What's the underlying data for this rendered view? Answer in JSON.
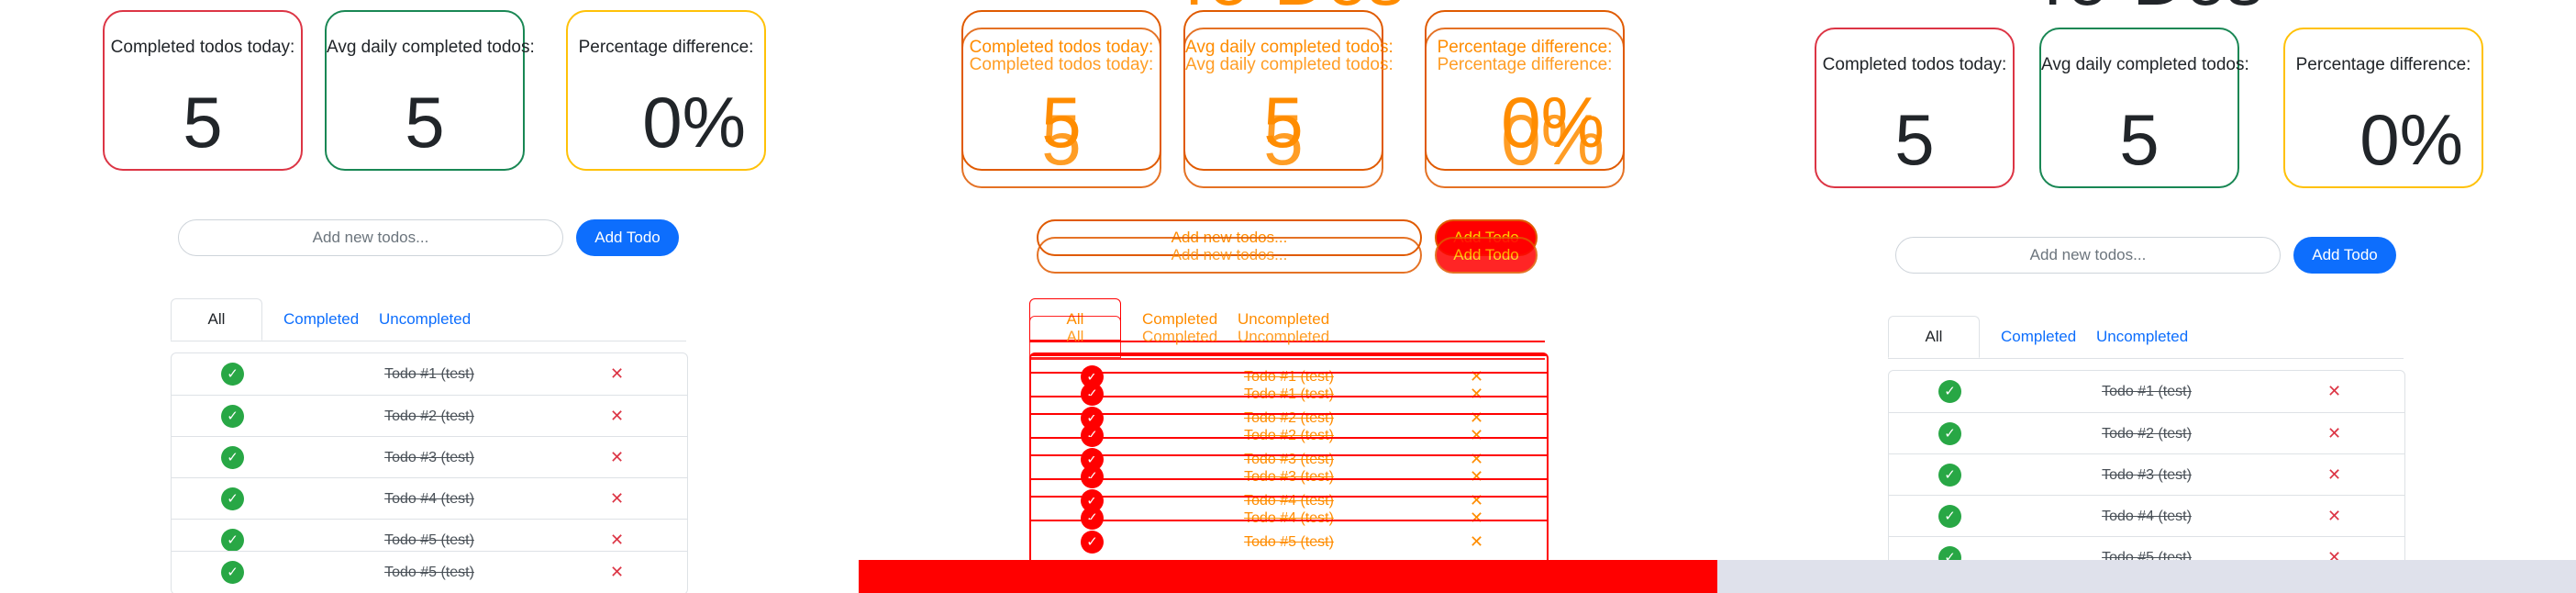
{
  "app": {
    "title": "To-Dos"
  },
  "stats": {
    "completed_today_label": "Completed todos today:",
    "completed_today_value": "5",
    "avg_daily_label": "Avg daily completed todos:",
    "avg_daily_value": "5",
    "percentage_label": "Percentage difference:",
    "percentage_value": "0%"
  },
  "form": {
    "placeholder": "Add new todos...",
    "add_label": "Add Todo"
  },
  "tabs": {
    "all": "All",
    "completed": "Completed",
    "uncompleted": "Uncompleted"
  },
  "todos": [
    {
      "text": "Todo #1 (test)",
      "completed": true
    },
    {
      "text": "Todo #2 (test)",
      "completed": true
    },
    {
      "text": "Todo #3 (test)",
      "completed": true
    },
    {
      "text": "Todo #4 (test)",
      "completed": true
    },
    {
      "text": "Todo #5 (test)",
      "completed": true
    }
  ],
  "icons": {
    "check": "check-circle-icon",
    "delete": "close-icon"
  },
  "colors": {
    "card_red": "#dc3545",
    "card_green": "#198754",
    "card_yellow": "#ffc107",
    "primary": "#0d6efd",
    "check_green": "#28a745",
    "overlay_orange": "#ff8c00",
    "overlay_red": "#ff0000"
  }
}
